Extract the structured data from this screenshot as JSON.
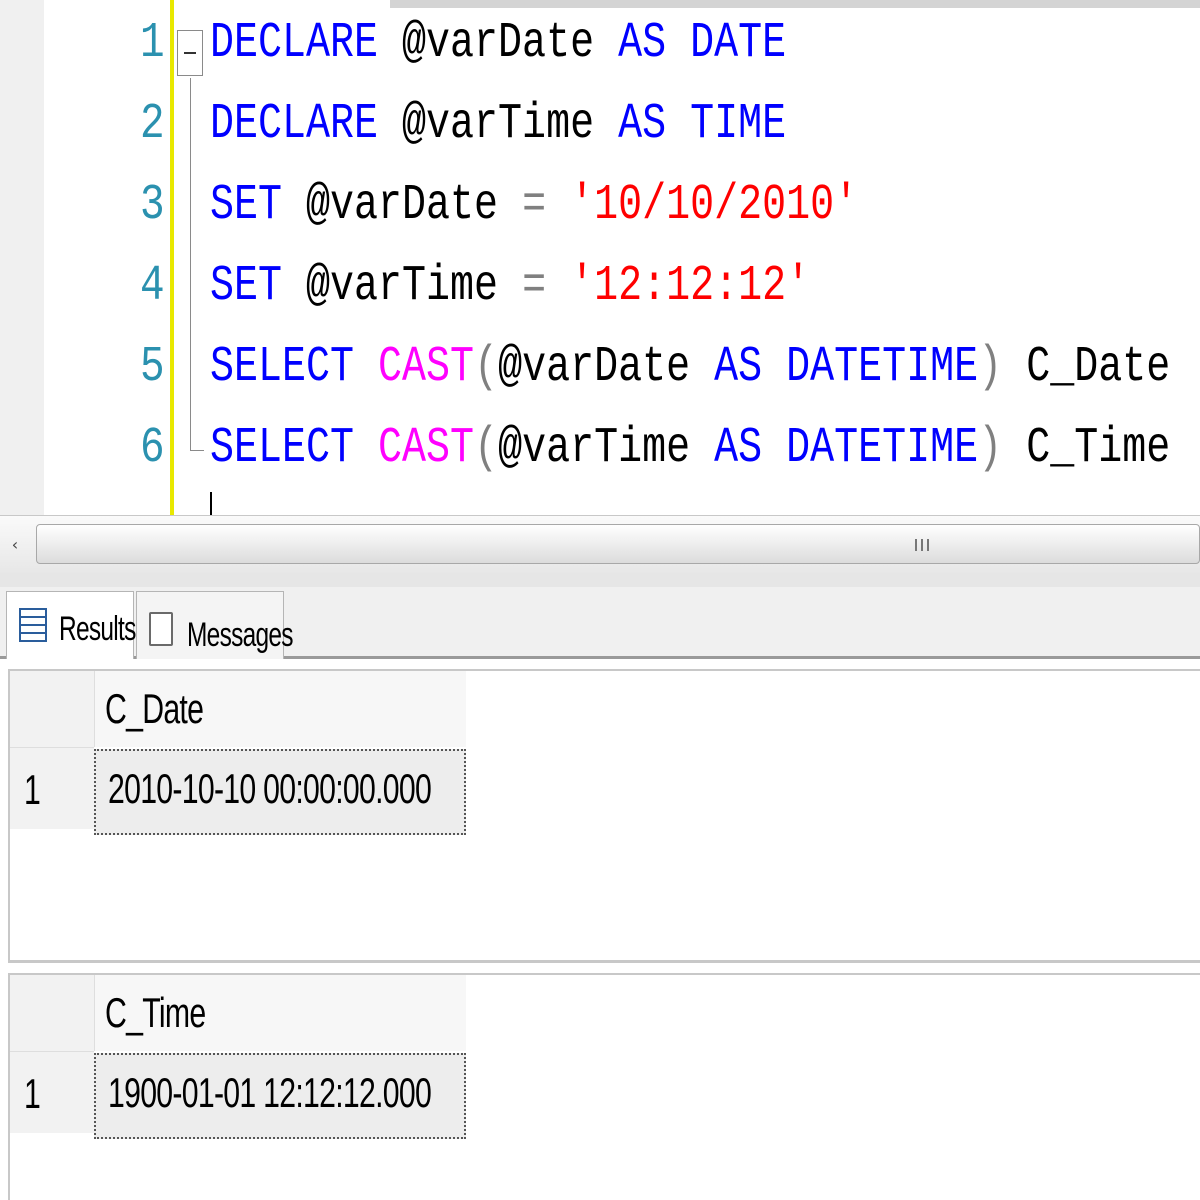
{
  "editor": {
    "lines": [
      {
        "num": "1",
        "parts": [
          {
            "t": "DECLARE",
            "c": "kw"
          },
          {
            "t": " @varDate ",
            "c": "var"
          },
          {
            "t": "AS",
            "c": "kw"
          },
          {
            "t": " ",
            "c": "var"
          },
          {
            "t": "DATE",
            "c": "kw"
          }
        ]
      },
      {
        "num": "2",
        "parts": [
          {
            "t": "DECLARE",
            "c": "kw"
          },
          {
            "t": " @varTime ",
            "c": "var"
          },
          {
            "t": "AS",
            "c": "kw"
          },
          {
            "t": " ",
            "c": "var"
          },
          {
            "t": "TIME",
            "c": "kw"
          }
        ]
      },
      {
        "num": "3",
        "parts": [
          {
            "t": "SET",
            "c": "kw"
          },
          {
            "t": " @varDate ",
            "c": "var"
          },
          {
            "t": "=",
            "c": "op"
          },
          {
            "t": " ",
            "c": "var"
          },
          {
            "t": "'10/10/2010'",
            "c": "str"
          }
        ]
      },
      {
        "num": "4",
        "parts": [
          {
            "t": "SET",
            "c": "kw"
          },
          {
            "t": " @varTime ",
            "c": "var"
          },
          {
            "t": "=",
            "c": "op"
          },
          {
            "t": " ",
            "c": "var"
          },
          {
            "t": "'12:12:12'",
            "c": "str"
          }
        ]
      },
      {
        "num": "5",
        "parts": [
          {
            "t": "SELECT",
            "c": "kw"
          },
          {
            "t": " ",
            "c": "var"
          },
          {
            "t": "CAST",
            "c": "fn"
          },
          {
            "t": "(",
            "c": "op"
          },
          {
            "t": "@varDate ",
            "c": "var"
          },
          {
            "t": "AS",
            "c": "kw"
          },
          {
            "t": " ",
            "c": "var"
          },
          {
            "t": "DATETIME",
            "c": "kw"
          },
          {
            "t": ")",
            "c": "op"
          },
          {
            "t": " C_Date",
            "c": "var"
          }
        ]
      },
      {
        "num": "6",
        "parts": [
          {
            "t": "SELECT",
            "c": "kw"
          },
          {
            "t": " ",
            "c": "var"
          },
          {
            "t": "CAST",
            "c": "fn"
          },
          {
            "t": "(",
            "c": "op"
          },
          {
            "t": "@varTime ",
            "c": "var"
          },
          {
            "t": "AS",
            "c": "kw"
          },
          {
            "t": " ",
            "c": "var"
          },
          {
            "t": "DATETIME",
            "c": "kw"
          },
          {
            "t": ")",
            "c": "op"
          },
          {
            "t": " C_Time",
            "c": "var"
          }
        ]
      }
    ],
    "colors": {
      "keyword": "#0000ff",
      "function": "#ff00ff",
      "string": "#ff0000",
      "operator": "#808080",
      "line_number": "#2b91af"
    }
  },
  "scrollbar": {
    "left_arrow": "‹",
    "thumb_grip": "grip-icon"
  },
  "tabs": [
    {
      "label": "Results",
      "icon": "grid-icon",
      "selected": true
    },
    {
      "label": "Messages",
      "icon": "messages-icon",
      "selected": false
    }
  ],
  "results": [
    {
      "column": "C_Date",
      "rows": [
        {
          "num": "1",
          "value": "2010-10-10 00:00:00.000"
        }
      ]
    },
    {
      "column": "C_Time",
      "rows": [
        {
          "num": "1",
          "value": "1900-01-01 12:12:12.000"
        }
      ]
    }
  ]
}
